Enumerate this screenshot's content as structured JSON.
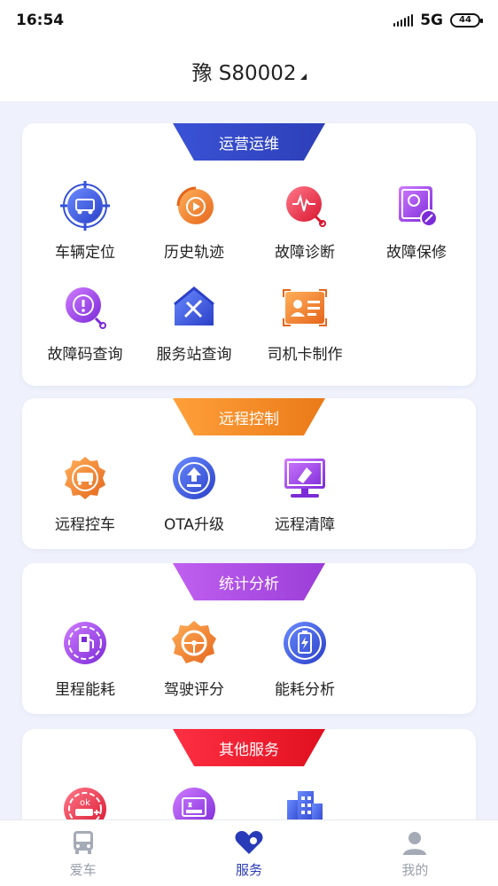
{
  "status_bar": {
    "time": "16:54",
    "network": "5G",
    "battery": "44"
  },
  "header": {
    "plate": "豫 S80002"
  },
  "sections": [
    {
      "title": "运营运维",
      "color": "#2f47c6",
      "items": [
        {
          "label": "车辆定位",
          "icon": "vehicle-locate-icon"
        },
        {
          "label": "历史轨迹",
          "icon": "history-track-icon"
        },
        {
          "label": "故障诊断",
          "icon": "fault-diagnosis-icon"
        },
        {
          "label": "故障保修",
          "icon": "fault-repair-icon"
        },
        {
          "label": "故障码查询",
          "icon": "fault-code-icon"
        },
        {
          "label": "服务站查询",
          "icon": "service-station-icon"
        },
        {
          "label": "司机卡制作",
          "icon": "driver-card-icon"
        }
      ]
    },
    {
      "title": "远程控制",
      "color": "#ee8a22",
      "items": [
        {
          "label": "远程控车",
          "icon": "remote-control-icon"
        },
        {
          "label": "OTA升级",
          "icon": "ota-upgrade-icon"
        },
        {
          "label": "远程清障",
          "icon": "remote-clear-icon"
        }
      ]
    },
    {
      "title": "统计分析",
      "color": "#a444e0",
      "items": [
        {
          "label": "里程能耗",
          "icon": "mileage-energy-icon"
        },
        {
          "label": "驾驶评分",
          "icon": "driving-score-icon"
        },
        {
          "label": "能耗分析",
          "icon": "energy-analysis-icon"
        }
      ]
    },
    {
      "title": "其他服务",
      "color": "#e8192c",
      "items": [
        {
          "label": "",
          "icon": "ok-service-icon"
        },
        {
          "label": "",
          "icon": "display-service-icon"
        },
        {
          "label": "",
          "icon": "building-service-icon"
        }
      ]
    }
  ],
  "tabbar": {
    "tabs": [
      {
        "label": "爱车",
        "icon": "car-icon",
        "active": false
      },
      {
        "label": "服务",
        "icon": "service-heart-icon",
        "active": true
      },
      {
        "label": "我的",
        "icon": "profile-icon",
        "active": false
      }
    ]
  }
}
